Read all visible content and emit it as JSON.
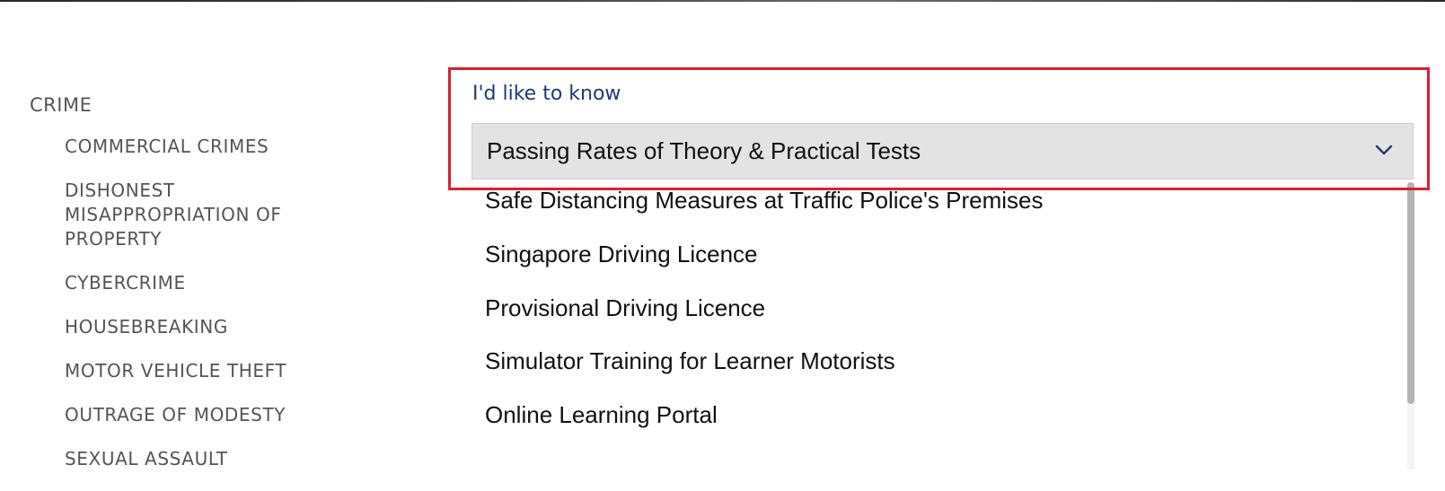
{
  "sidebar": {
    "heading": "CRIME",
    "items": [
      {
        "label": "COMMERCIAL CRIMES"
      },
      {
        "label": "DISHONEST MISAPPROPRIATION OF PROPERTY"
      },
      {
        "label": "CYBERCRIME"
      },
      {
        "label": "HOUSEBREAKING"
      },
      {
        "label": "MOTOR VEHICLE THEFT"
      },
      {
        "label": "OUTRAGE OF MODESTY"
      },
      {
        "label": "SEXUAL ASSAULT"
      }
    ]
  },
  "selector": {
    "label": "I'd like to know",
    "selected": "Passing Rates of Theory & Practical Tests",
    "chevron_icon": "chevron-down-icon",
    "options": [
      {
        "label": "Safe Distancing Measures at Traffic Police's Premises"
      },
      {
        "label": "Singapore Driving Licence"
      },
      {
        "label": "Provisional Driving Licence"
      },
      {
        "label": "Simulator Training for Learner Motorists"
      },
      {
        "label": "Online Learning Portal"
      }
    ]
  },
  "colors": {
    "highlight": "#d9202f",
    "label_blue": "#1f3a73",
    "select_bg": "#e3e3e3",
    "nav_text": "#555555"
  }
}
